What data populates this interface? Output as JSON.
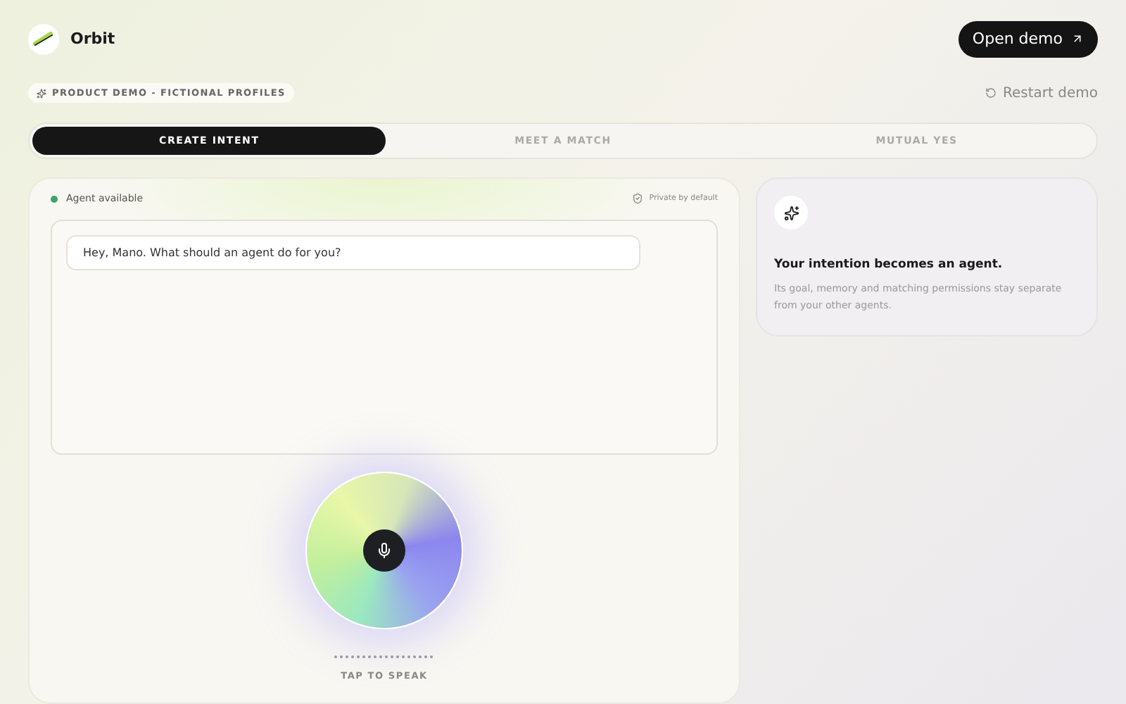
{
  "header": {
    "brand": "Orbit",
    "open_button": "Open demo",
    "badge": "PRODUCT DEMO - FICTIONAL PROFILES",
    "restart": "Restart demo"
  },
  "tabs": [
    {
      "label": "CREATE INTENT",
      "selected": true
    },
    {
      "label": "MEET A MATCH",
      "selected": false
    },
    {
      "label": "MUTUAL YES",
      "selected": false
    }
  ],
  "agent_panel": {
    "status": "Agent available",
    "status_on": true,
    "privacy": "Private by default",
    "prompt": "Hey, Mano. What should an agent do for you?",
    "voice_hint": "TAP TO SPEAK"
  },
  "info_card": {
    "title": "Your intention becomes an agent.",
    "body": "Its goal, memory and matching permissions stay separate from your other agents."
  }
}
